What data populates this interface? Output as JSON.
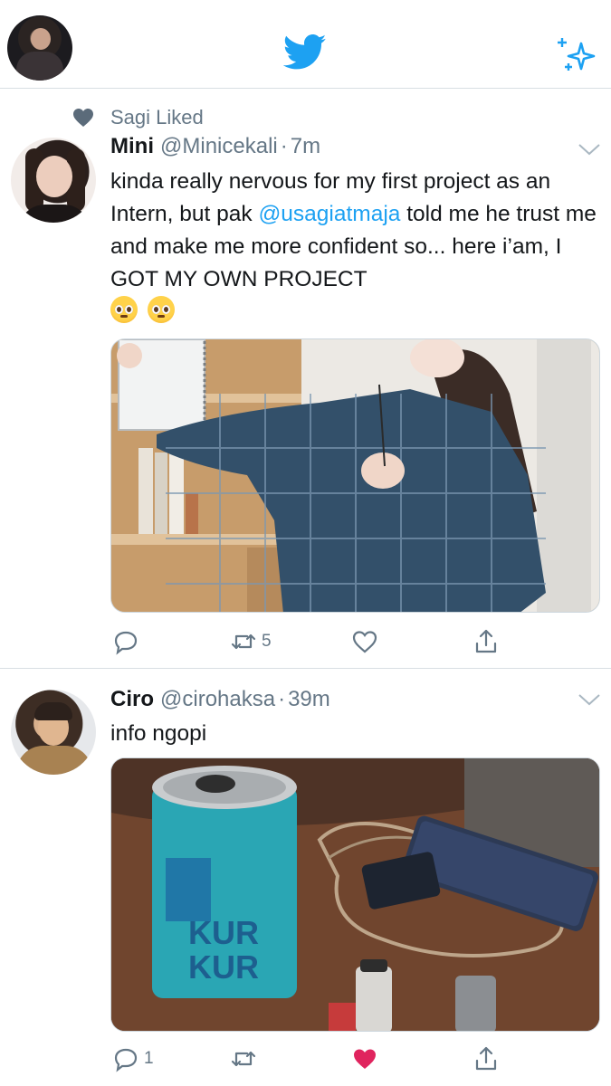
{
  "header": {
    "avatar_icon": "user-avatar",
    "logo_icon": "twitter-bird-icon",
    "sparkle_icon": "sparkle-icon",
    "brand_color": "#1DA1F2"
  },
  "tweets": [
    {
      "social_context": "Sagi Liked",
      "social_icon": "heart-icon",
      "name": "Mini",
      "handle": "@Minicekali",
      "dot": "·",
      "time": "7m",
      "text_parts": [
        "kinda really nervous for my first project as an Intern, but pak ",
        "@usagiatmaja",
        " told me he trust me and make me more confident so... here i’am, I GOT MY OWN PROJECT"
      ],
      "emojis": [
        "pleading-face",
        "pleading-face"
      ],
      "media_description_icon": "photo-girl-holding-notebook",
      "actions": {
        "reply_count": "",
        "retweet_count": "5",
        "like_count": "",
        "liked": false
      }
    },
    {
      "name": "Ciro",
      "handle": "@cirohaksa",
      "dot": "·",
      "time": "39m",
      "text": "info ngopi",
      "media_description_icon": "photo-can-and-powerbank",
      "actions": {
        "reply_count": "1",
        "retweet_count": "",
        "like_count": "",
        "liked": true,
        "liked_color": "#E0245E"
      }
    }
  ]
}
